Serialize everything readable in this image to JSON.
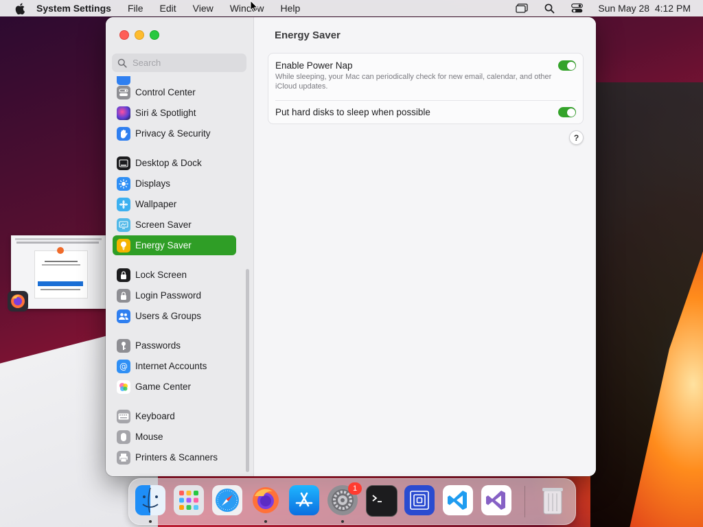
{
  "menubar": {
    "app_name": "System Settings",
    "menus": [
      "File",
      "Edit",
      "View",
      "Window",
      "Help"
    ],
    "datetime": "Sun May 28  4:12 PM"
  },
  "sidebar": {
    "search_placeholder": "Search",
    "items": [
      {
        "label": "Control Center",
        "icon": "control-center-icon",
        "color": "#8e8e93"
      },
      {
        "label": "Siri & Spotlight",
        "icon": "siri-icon",
        "color": "#5b3fd6"
      },
      {
        "label": "Privacy & Security",
        "icon": "hand-icon",
        "color": "#2f7ff0"
      },
      {
        "label": "Desktop & Dock",
        "icon": "dock-icon",
        "color": "#1c1c1e"
      },
      {
        "label": "Displays",
        "icon": "sun-icon",
        "color": "#2f8ff5"
      },
      {
        "label": "Wallpaper",
        "icon": "flower-icon",
        "color": "#3cb0f0"
      },
      {
        "label": "Screen Saver",
        "icon": "screen-saver-icon",
        "color": "#50b8e8"
      },
      {
        "label": "Energy Saver",
        "icon": "bulb-icon",
        "color": "#f5b400",
        "selected": true
      },
      {
        "label": "Lock Screen",
        "icon": "lock-icon",
        "color": "#1c1c1e"
      },
      {
        "label": "Login Password",
        "icon": "lock-outline-icon",
        "color": "#8e8e93"
      },
      {
        "label": "Users & Groups",
        "icon": "users-icon",
        "color": "#2f7ff0"
      },
      {
        "label": "Passwords",
        "icon": "key-icon",
        "color": "#8e8e93"
      },
      {
        "label": "Internet Accounts",
        "icon": "at-icon",
        "color": "#2f8ff5"
      },
      {
        "label": "Game Center",
        "icon": "game-center-icon",
        "color": "#ffffff"
      },
      {
        "label": "Keyboard",
        "icon": "keyboard-icon",
        "color": "#a5a5aa"
      },
      {
        "label": "Mouse",
        "icon": "mouse-icon",
        "color": "#a5a5aa"
      },
      {
        "label": "Printers & Scanners",
        "icon": "printer-icon",
        "color": "#a5a5aa"
      }
    ],
    "selected_color": "#2f9e26"
  },
  "content": {
    "title": "Energy Saver",
    "settings": [
      {
        "label": "Enable Power Nap",
        "description": "While sleeping, your Mac can periodically check for new email, calendar, and other iCloud updates.",
        "enabled": true
      },
      {
        "label": "Put hard disks to sleep when possible",
        "description": "",
        "enabled": true
      }
    ],
    "help_label": "?"
  },
  "dock": {
    "items": [
      "Finder",
      "Launchpad",
      "Safari",
      "Firefox",
      "App Store",
      "System Settings",
      "Terminal",
      "Remote Desktop",
      "Visual Studio Code",
      "Visual Studio",
      "Trash"
    ],
    "badge": "1"
  }
}
